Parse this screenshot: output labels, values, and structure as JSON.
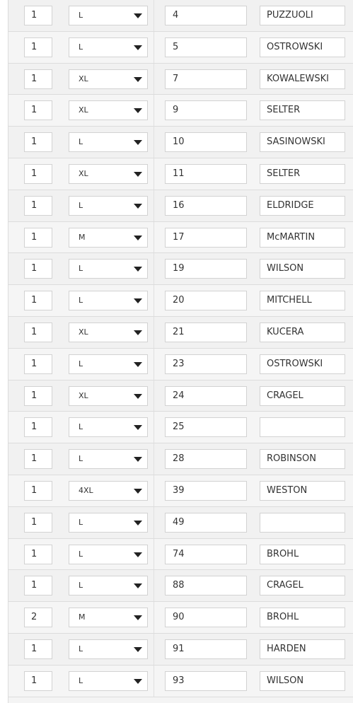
{
  "rows": [
    {
      "qty": "1",
      "size": "L",
      "number": "4",
      "name": "PUZZUOLI"
    },
    {
      "qty": "1",
      "size": "L",
      "number": "5",
      "name": "OSTROWSKI"
    },
    {
      "qty": "1",
      "size": "XL",
      "number": "7",
      "name": "KOWALEWSKI"
    },
    {
      "qty": "1",
      "size": "XL",
      "number": "9",
      "name": "SELTER"
    },
    {
      "qty": "1",
      "size": "L",
      "number": "10",
      "name": "SASINOWSKI"
    },
    {
      "qty": "1",
      "size": "XL",
      "number": "11",
      "name": "SELTER"
    },
    {
      "qty": "1",
      "size": "L",
      "number": "16",
      "name": "ELDRIDGE"
    },
    {
      "qty": "1",
      "size": "M",
      "number": "17",
      "name": "McMARTIN"
    },
    {
      "qty": "1",
      "size": "L",
      "number": "19",
      "name": "WILSON"
    },
    {
      "qty": "1",
      "size": "L",
      "number": "20",
      "name": "MITCHELL"
    },
    {
      "qty": "1",
      "size": "XL",
      "number": "21",
      "name": "KUCERA"
    },
    {
      "qty": "1",
      "size": "L",
      "number": "23",
      "name": "OSTROWSKI"
    },
    {
      "qty": "1",
      "size": "XL",
      "number": "24",
      "name": "CRAGEL"
    },
    {
      "qty": "1",
      "size": "L",
      "number": "25",
      "name": ""
    },
    {
      "qty": "1",
      "size": "L",
      "number": "28",
      "name": "ROBINSON"
    },
    {
      "qty": "1",
      "size": "4XL",
      "number": "39",
      "name": "WESTON"
    },
    {
      "qty": "1",
      "size": "L",
      "number": "49",
      "name": ""
    },
    {
      "qty": "1",
      "size": "L",
      "number": "74",
      "name": "BROHL"
    },
    {
      "qty": "1",
      "size": "L",
      "number": "88",
      "name": "CRAGEL"
    },
    {
      "qty": "2",
      "size": "M",
      "number": "90",
      "name": "BROHL"
    },
    {
      "qty": "1",
      "size": "L",
      "number": "91",
      "name": "HARDEN"
    },
    {
      "qty": "1",
      "size": "L",
      "number": "93",
      "name": "WILSON"
    }
  ]
}
